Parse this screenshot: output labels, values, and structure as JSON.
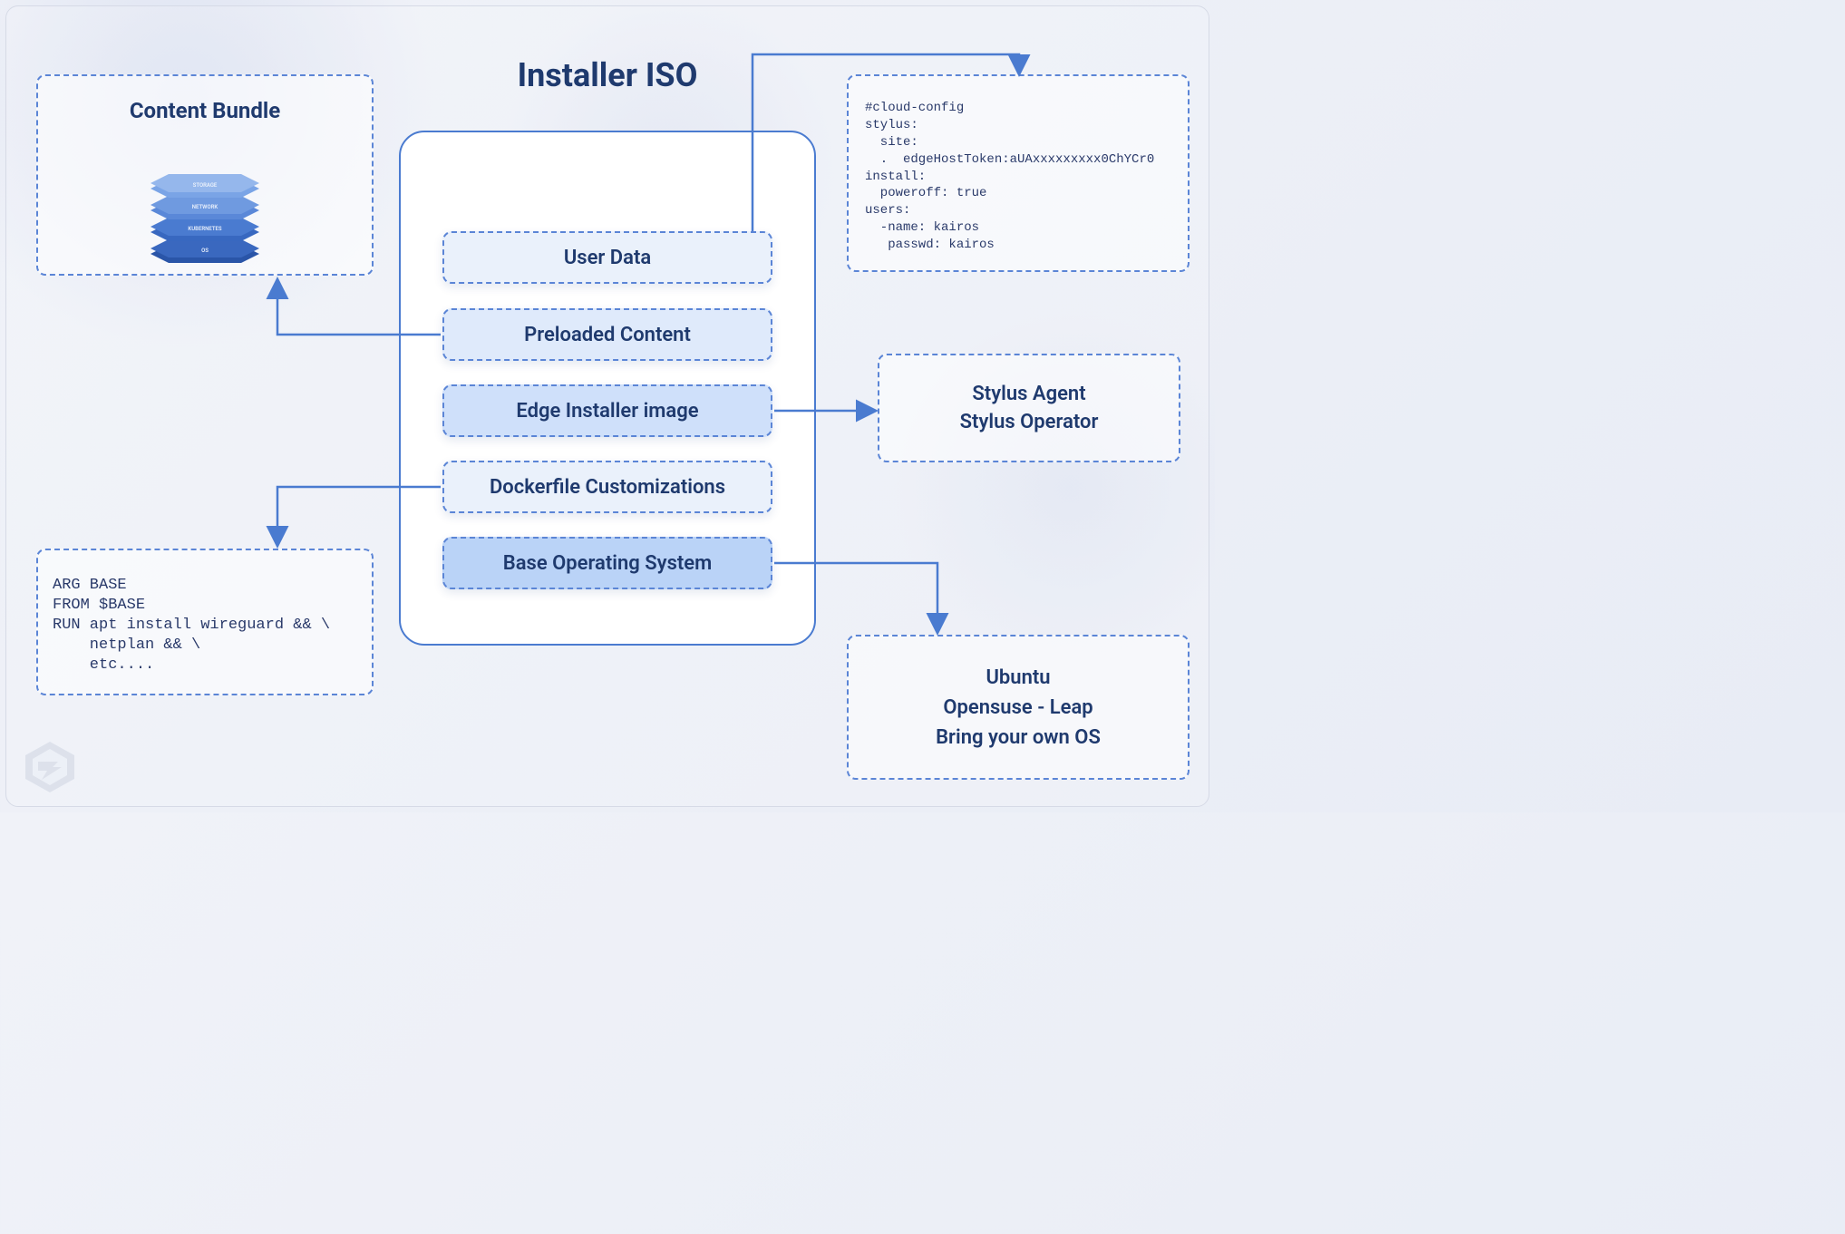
{
  "title": "Installer ISO",
  "layers": {
    "user_data": "User Data",
    "preloaded_content": "Preloaded Content",
    "edge_installer": "Edge Installer image",
    "dockerfile_custom": "Dockerfile Customizations",
    "base_os": "Base Operating System"
  },
  "content_bundle": {
    "title": "Content Bundle",
    "stack_labels": [
      "STORAGE",
      "NETWORK",
      "KUBERNETES",
      "OS"
    ]
  },
  "cloud_config_text": "#cloud-config\nstylus:\n  site:\n  .  edgeHostToken:aUAxxxxxxxxx0ChYCr0\ninstall:\n  poweroff: true\nusers:\n  -name: kairos\n   passwd: kairos",
  "stylus": {
    "line1": "Stylus Agent",
    "line2": "Stylus Operator"
  },
  "dockerfile_text": "ARG BASE\nFROM $BASE\nRUN apt install wireguard && \\\n    netplan && \\\n    etc....",
  "os_options": {
    "opt1": "Ubuntu",
    "opt2": "Opensuse - Leap",
    "opt3": "Bring your own OS"
  },
  "colors": {
    "primary": "#4a7bd0",
    "text": "#1f3a6e"
  }
}
